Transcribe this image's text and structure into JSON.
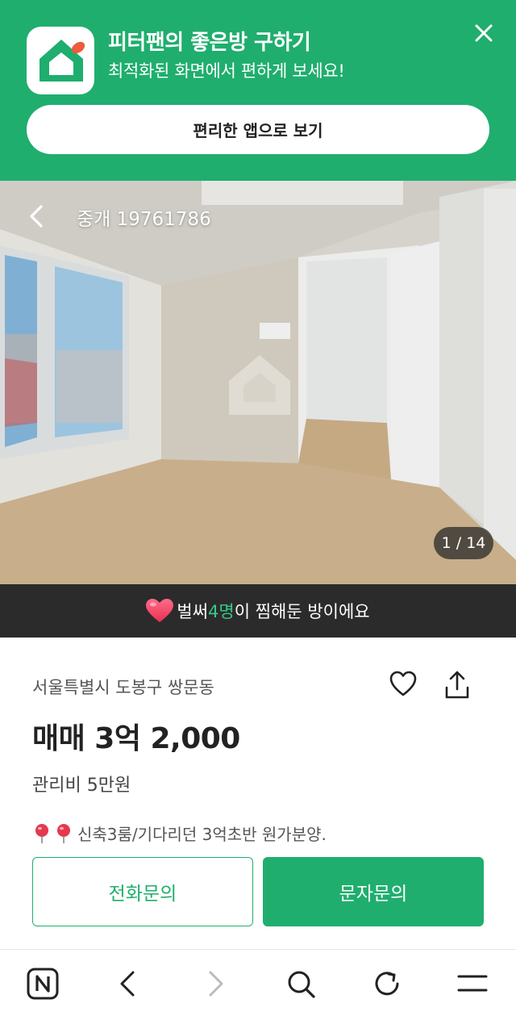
{
  "banner": {
    "title": "피터팬의 좋은방 구하기",
    "subtitle": "최적화된 화면에서 편하게 보세요!",
    "open_app_label": "편리한 앱으로 보기",
    "close_icon": "close-icon",
    "brand_color": "#1fae6e"
  },
  "photo": {
    "listing_id": "중개 19761786",
    "counter": "1 / 14",
    "back_icon": "chevron-left-icon"
  },
  "favorites": {
    "prefix": "벌써 ",
    "count": "4명",
    "suffix": "이 찜해둔 방이에요",
    "icon": "heart-icon",
    "highlight_color": "#36c98a"
  },
  "listing": {
    "address": "서울특별시 도봉구 쌍문동",
    "price": "매매 3억 2,000",
    "management_fee": "관리비 5만원",
    "description": "신축3룸/기다리던 3억초반 원가분양."
  },
  "actions": {
    "call_label": "전화문의",
    "sms_label": "문자문의"
  },
  "browser_bar": {
    "items": [
      "naver-home-icon",
      "back-icon",
      "forward-icon",
      "search-icon",
      "refresh-icon",
      "menu-icon"
    ]
  }
}
